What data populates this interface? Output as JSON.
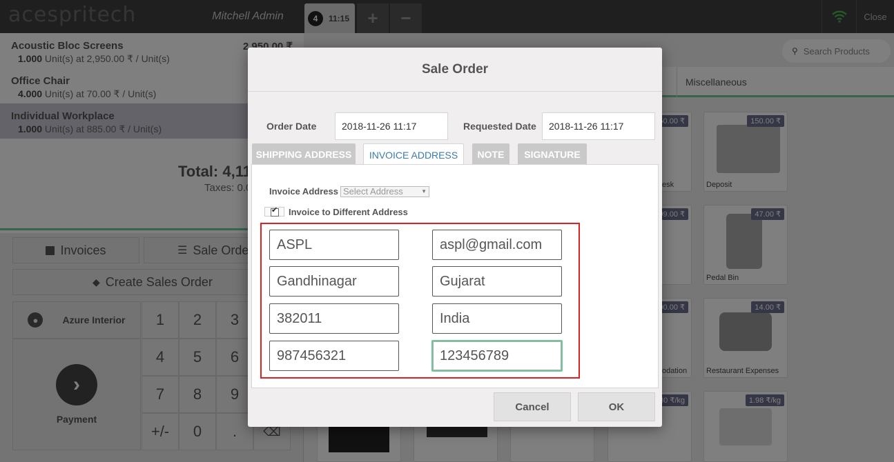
{
  "header": {
    "logo": "acespritech",
    "user": "Mitchell Admin",
    "order_number": "4",
    "order_time": "11:15",
    "add_label": "+",
    "remove_label": "−",
    "close_label": "Close"
  },
  "orderlines": [
    {
      "name": "Acoustic Bloc Screens",
      "price": "2,950.00 ₹",
      "qty": "1.000",
      "info": " Unit(s) at 2,950.00 ₹ / Unit(s)"
    },
    {
      "name": "Office Chair",
      "price": "",
      "qty": "4.000",
      "info": " Unit(s) at 70.00 ₹ / Unit(s)"
    },
    {
      "name": "Individual Workplace",
      "price": "",
      "qty": "1.000",
      "info": " Unit(s) at 885.00 ₹ / Unit(s)"
    }
  ],
  "summary": {
    "total": "Total: 4,11",
    "taxes": "Taxes: 0.0"
  },
  "actions": {
    "invoices": "Invoices",
    "sale_order": "Sale Orde",
    "create_sales_order": "Create Sales Order"
  },
  "customer": "Azure Interior",
  "payment": "Payment",
  "numpad": [
    "1",
    "2",
    "3",
    "4",
    "5",
    "6",
    "7",
    "8",
    "9",
    "+/-",
    "0",
    "."
  ],
  "search_placeholder": "Search Products",
  "category": "Miscellaneous",
  "products": [
    {
      "name": "esk",
      "price": "50.00 ₹"
    },
    {
      "name": "Deposit",
      "price": "150.00 ₹"
    },
    {
      "name": "",
      "price": "99.00 ₹"
    },
    {
      "name": "Pedal Bin",
      "price": "47.00 ₹"
    },
    {
      "name": "odation",
      "price": "00.00 ₹"
    },
    {
      "name": "Restaurant Expenses",
      "price": "14.00 ₹"
    },
    {
      "name": "",
      "price": "30 ₹/kg"
    },
    {
      "name": "",
      "price": "1.98 ₹/kg"
    }
  ],
  "modal": {
    "title": "Sale Order",
    "order_date_label": "Order Date",
    "order_date": "2018-11-26 11:17",
    "requested_date_label": "Requested Date",
    "requested_date": "2018-11-26 11:17",
    "tabs": [
      "SHIPPING ADDRESS",
      "INVOICE ADDRESS",
      "NOTE",
      "SIGNATURE"
    ],
    "invoice_address_label": "Invoice Address",
    "invoice_address_select": "Select Address",
    "checkbox_mark": "✔",
    "different_address_label": "Invoice to Different Address",
    "fields": {
      "name": "ASPL",
      "email": "aspl@gmail.com",
      "city": "Gandhinagar",
      "state": "Gujarat",
      "zip": "382011",
      "country": "India",
      "mobile": "987456321",
      "phone": "123456789"
    },
    "cancel_label": "Cancel",
    "ok_label": "OK"
  }
}
